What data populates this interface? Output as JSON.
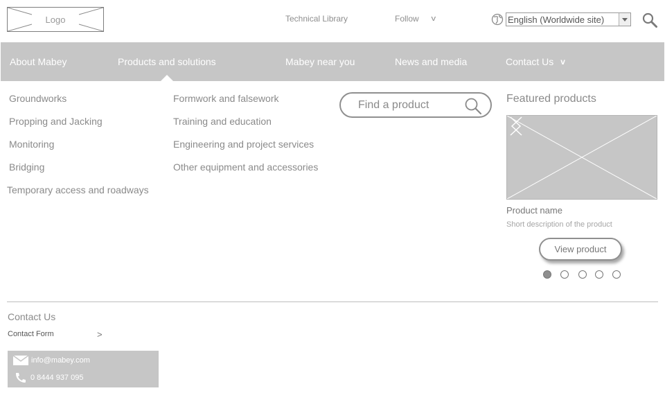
{
  "header": {
    "logo_label": "Logo",
    "technical_library": "Technical Library",
    "follow": "Follow",
    "follow_chevron": "v",
    "language": "English (Worldwide site)"
  },
  "nav": {
    "items": [
      {
        "label": "About Mabey"
      },
      {
        "label": "Products and solutions"
      },
      {
        "label": "Mabey near you"
      },
      {
        "label": "News and media"
      },
      {
        "label": "Contact Us"
      }
    ],
    "contact_chevron": "v"
  },
  "menu": {
    "col1": [
      "Groundworks",
      "Propping and Jacking",
      "Monitoring",
      "Bridging",
      "Temporary access and roadways"
    ],
    "col2": [
      "Formwork and falsework",
      "Training and education",
      "Engineering and project services",
      "Other equipment and accessories"
    ]
  },
  "search": {
    "placeholder": "Find a product"
  },
  "featured": {
    "title": "Featured products",
    "product_name": "Product name",
    "product_description": "Short description of the product",
    "view_button": "View product",
    "carousel_count": 5,
    "active_index": 0
  },
  "footer": {
    "contact_title": "Contact Us",
    "contact_form": "Contact Form",
    "contact_form_arrow": ">",
    "email": "info@mabey.com",
    "phone": "0 8444 937 095"
  },
  "colors": {
    "nav_background": "#c6c6c6",
    "text_gray": "#8a8a8a"
  },
  "icons": [
    "globe-icon",
    "search-icon",
    "chevron-left-icon",
    "chevron-right-icon",
    "envelope-icon",
    "phone-icon"
  ]
}
